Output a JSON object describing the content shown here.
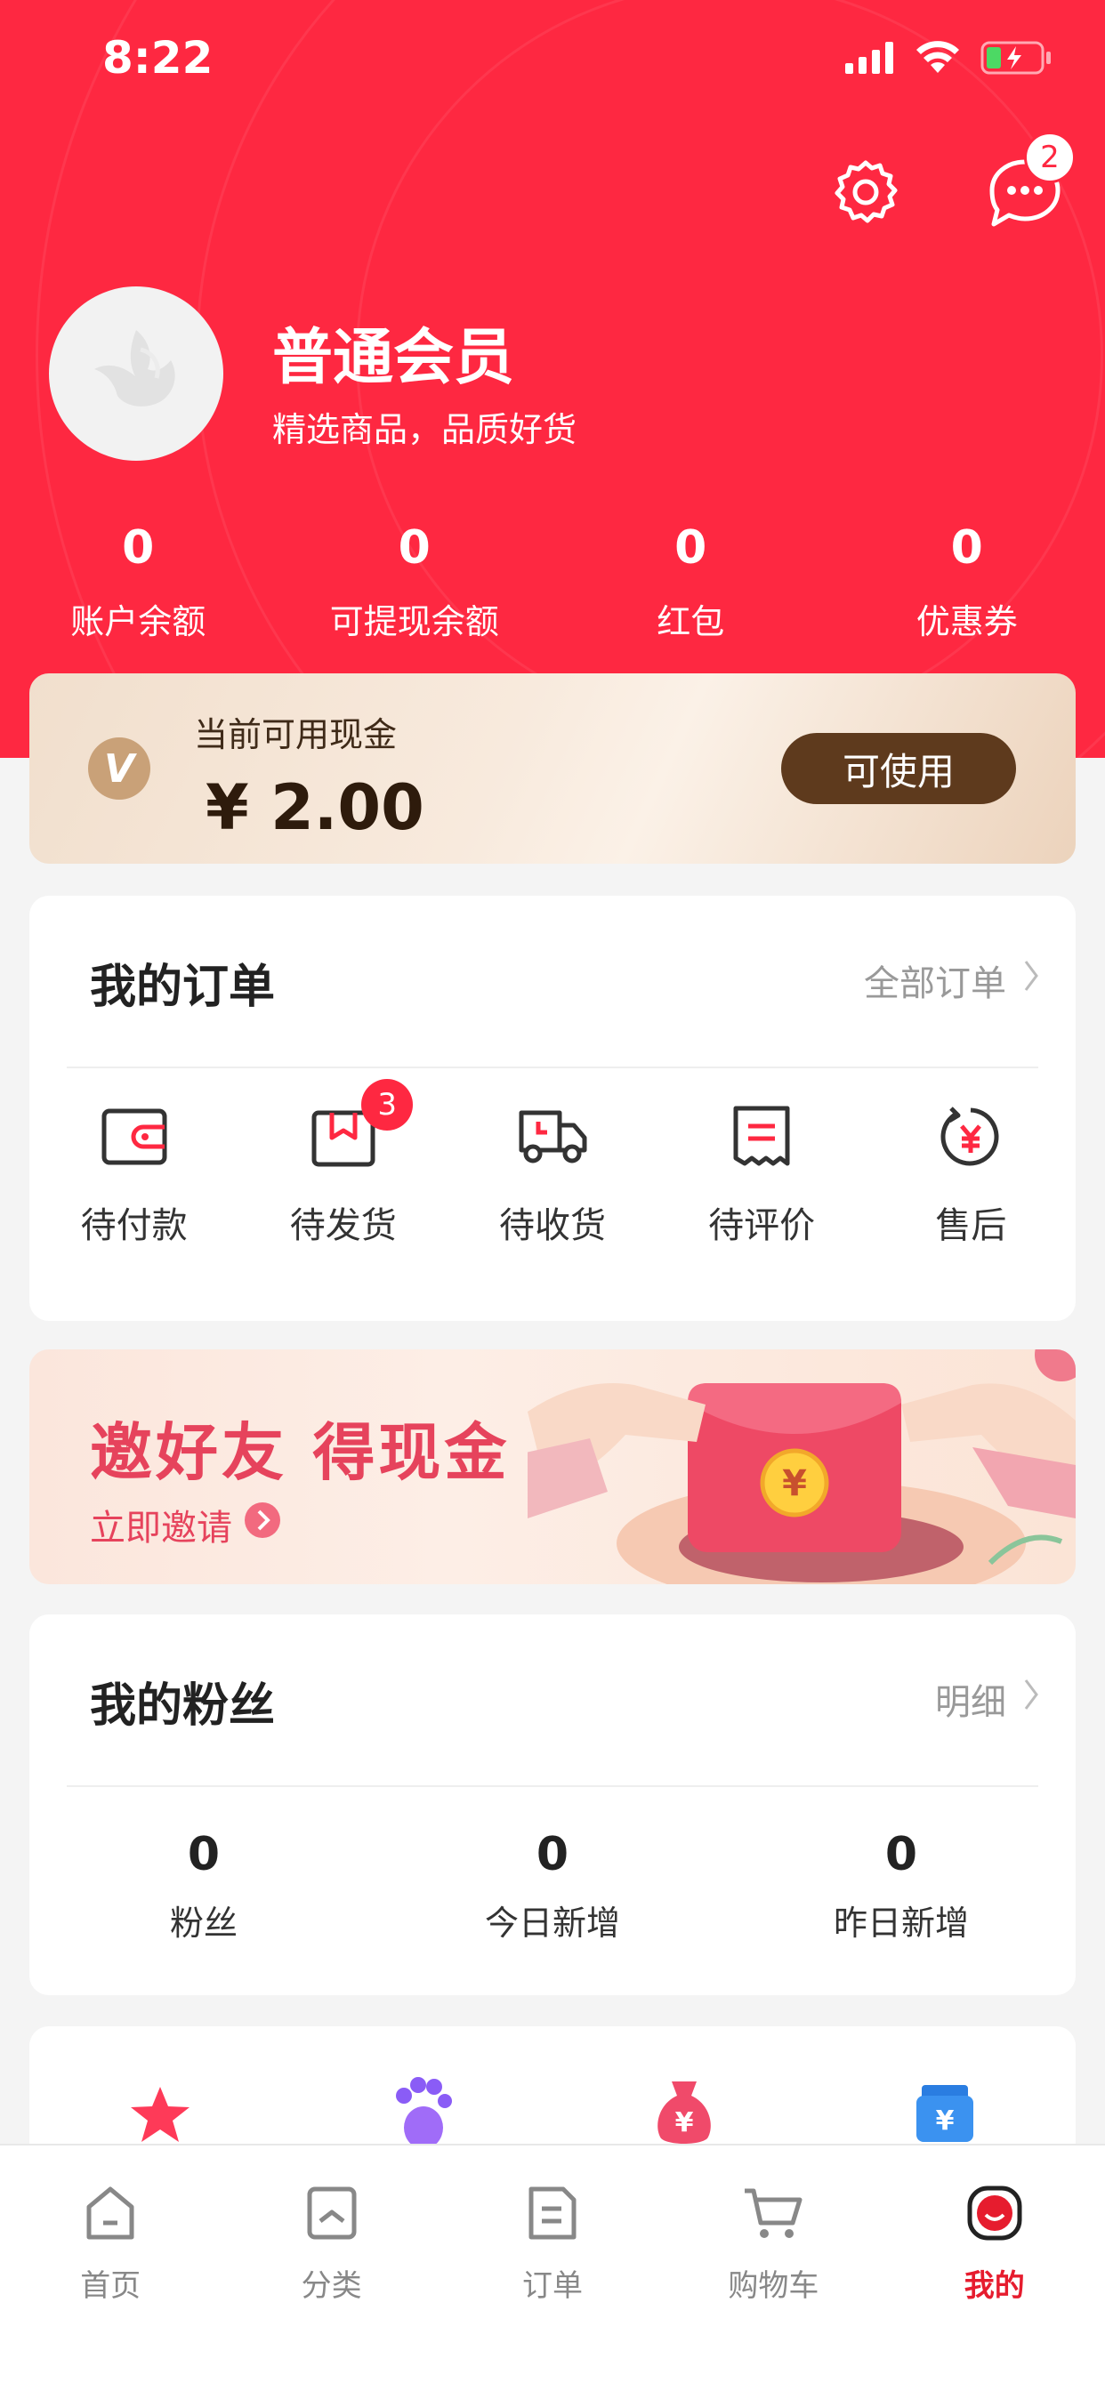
{
  "status_bar": {
    "time": "8:22"
  },
  "header": {
    "message_badge": "2",
    "member_name": "普通会员",
    "member_slogan": "精选商品，品质好货"
  },
  "stats": [
    {
      "value": "0",
      "label": "账户余额"
    },
    {
      "value": "0",
      "label": "可提现余额"
    },
    {
      "value": "0",
      "label": "红包"
    },
    {
      "value": "0",
      "label": "优惠券"
    }
  ],
  "cash_card": {
    "label": "当前可用现金",
    "amount": "¥ 2.00",
    "button": "可使用"
  },
  "orders": {
    "title": "我的订单",
    "link": "全部订单",
    "items": [
      {
        "label": "待付款",
        "icon": "wallet-icon"
      },
      {
        "label": "待发货",
        "icon": "box-icon",
        "badge": "3"
      },
      {
        "label": "待收货",
        "icon": "truck-icon"
      },
      {
        "label": "待评价",
        "icon": "review-icon"
      },
      {
        "label": "售后",
        "icon": "refund-icon"
      }
    ]
  },
  "invite_banner": {
    "title": "邀好友 得现金",
    "link": "立即邀请"
  },
  "fans": {
    "title": "我的粉丝",
    "link": "明细",
    "items": [
      {
        "value": "0",
        "label": "粉丝"
      },
      {
        "value": "0",
        "label": "今日新增"
      },
      {
        "value": "0",
        "label": "昨日新增"
      }
    ]
  },
  "bottom_nav": [
    {
      "label": "首页",
      "icon": "home-icon"
    },
    {
      "label": "分类",
      "icon": "category-icon"
    },
    {
      "label": "订单",
      "icon": "order-icon"
    },
    {
      "label": "购物车",
      "icon": "cart-icon"
    },
    {
      "label": "我的",
      "icon": "profile-icon",
      "active": true
    }
  ],
  "colors": {
    "brand_red": "#fe2841",
    "cash_button": "#5e3a1d",
    "banner_text": "#e6435c"
  }
}
